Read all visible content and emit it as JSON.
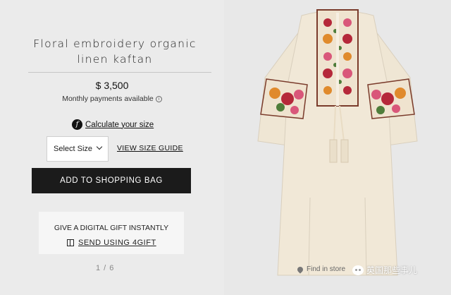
{
  "product": {
    "title": "Floral embroidery organic linen kaftan",
    "price": "$ 3,500",
    "monthly": "Monthly payments available",
    "monthly_info_icon": "info-icon"
  },
  "size": {
    "calc_label": "Calculate your size",
    "select_value": "Select Size",
    "guide_label": "VIEW SIZE GUIDE"
  },
  "cta": {
    "add_label": "ADD TO SHOPPING BAG"
  },
  "gift": {
    "title": "GIVE A DIGITAL GIFT INSTANTLY",
    "link_label": "SEND USING 4GIFT"
  },
  "pager": {
    "text": "1 / 6"
  },
  "image": {
    "find_in_store": "Find in store",
    "watermark": "英国那些事儿"
  },
  "colors": {
    "button": "#1b1b1b",
    "fabric": "#efe6d4",
    "embroidery_red": "#b5283a",
    "embroidery_pink": "#d9577a",
    "embroidery_orange": "#e08a2c",
    "embroidery_green": "#4f7d3a"
  }
}
